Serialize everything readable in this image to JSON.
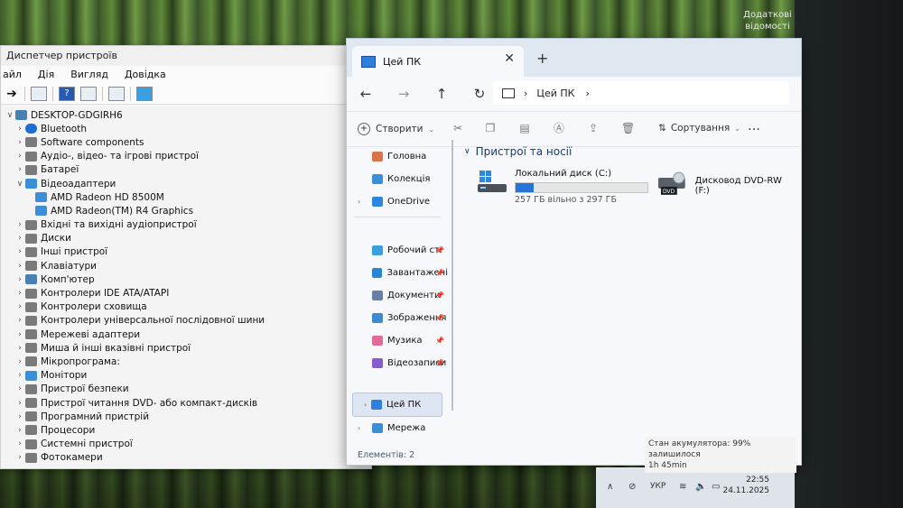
{
  "desktop": {
    "notification": "Додаткові відомості"
  },
  "device_manager": {
    "title": "Диспетчер пристроїв",
    "menu": [
      "айл",
      "Дія",
      "Вигляд",
      "Довідка"
    ],
    "tree": [
      {
        "label": "DESKTOP-GDGIRH6",
        "expander": "∨",
        "level": 0,
        "icon": "computer-icon"
      },
      {
        "label": "Bluetooth",
        "expander": "›",
        "level": 1,
        "icon": "bluetooth-icon"
      },
      {
        "label": "Software components",
        "expander": "›",
        "level": 1,
        "icon": "component-icon"
      },
      {
        "label": "Аудіо-, відео- та ігрові пристрої",
        "expander": "›",
        "level": 1,
        "icon": "speaker-icon"
      },
      {
        "label": "Батареї",
        "expander": "›",
        "level": 1,
        "icon": "battery-icon"
      },
      {
        "label": "Відеоадаптери",
        "expander": "∨",
        "level": 1,
        "icon": "display-adapter-icon"
      },
      {
        "label": "AMD Radeon HD 8500M",
        "expander": "",
        "level": 2,
        "icon": "display-adapter-icon"
      },
      {
        "label": "AMD Radeon(TM) R4 Graphics",
        "expander": "",
        "level": 2,
        "icon": "display-adapter-icon"
      },
      {
        "label": "Вхідні та вихідні аудіопристрої",
        "expander": "›",
        "level": 1,
        "icon": "audio-io-icon"
      },
      {
        "label": "Диски",
        "expander": "›",
        "level": 1,
        "icon": "disk-icon"
      },
      {
        "label": "Інші пристрої",
        "expander": "›",
        "level": 1,
        "icon": "unknown-device-icon"
      },
      {
        "label": "Клавіатури",
        "expander": "›",
        "level": 1,
        "icon": "keyboard-icon"
      },
      {
        "label": "Комп'ютер",
        "expander": "›",
        "level": 1,
        "icon": "computer-icon"
      },
      {
        "label": "Контролери IDE ATA/ATAPI",
        "expander": "›",
        "level": 1,
        "icon": "controller-icon"
      },
      {
        "label": "Контролери сховища",
        "expander": "›",
        "level": 1,
        "icon": "storage-icon"
      },
      {
        "label": "Контролери універсальної послідовної шини",
        "expander": "›",
        "level": 1,
        "icon": "usb-icon"
      },
      {
        "label": "Мережеві адаптери",
        "expander": "›",
        "level": 1,
        "icon": "network-icon"
      },
      {
        "label": "Миша й інші вказівні пристрої",
        "expander": "›",
        "level": 1,
        "icon": "mouse-icon"
      },
      {
        "label": "Мікропрограма:",
        "expander": "›",
        "level": 1,
        "icon": "firmware-icon"
      },
      {
        "label": "Монітори",
        "expander": "›",
        "level": 1,
        "icon": "monitor-icon"
      },
      {
        "label": "Пристрої безпеки",
        "expander": "›",
        "level": 1,
        "icon": "security-icon"
      },
      {
        "label": "Пристрої читання DVD- або компакт-дисків",
        "expander": "›",
        "level": 1,
        "icon": "dvd-icon"
      },
      {
        "label": "Програмний пристрій",
        "expander": "›",
        "level": 1,
        "icon": "software-device-icon"
      },
      {
        "label": "Процесори",
        "expander": "›",
        "level": 1,
        "icon": "cpu-icon"
      },
      {
        "label": "Системні пристрої",
        "expander": "›",
        "level": 1,
        "icon": "system-icon"
      },
      {
        "label": "Фотокамери",
        "expander": "›",
        "level": 1,
        "icon": "camera-icon"
      }
    ]
  },
  "explorer": {
    "tab_title": "Цей ПК",
    "tab_close": "✕",
    "new_tab": "+",
    "nav": {
      "back": "←",
      "forward": "→",
      "up": "↑",
      "refresh": "↻"
    },
    "address": {
      "location": "Цей ПК",
      "separator": "›"
    },
    "command_bar": {
      "new_label": "Створити",
      "sort_label": "Сортування",
      "more": "…"
    },
    "sidebar": {
      "top": [
        {
          "label": "Головна",
          "icon": "home-icon",
          "color": "#d9734a"
        },
        {
          "label": "Колекція",
          "icon": "gallery-icon",
          "color": "#3a8fd8"
        },
        {
          "label": "OneDrive",
          "icon": "onedrive-icon",
          "color": "#2f86e0"
        }
      ],
      "pinned": [
        {
          "label": "Робочий ст.",
          "icon": "desktop-icon",
          "color": "#3aa0e0"
        },
        {
          "label": "Завантажені",
          "icon": "download-icon",
          "color": "#2a86d1"
        },
        {
          "label": "Документи",
          "icon": "documents-icon",
          "color": "#6a7fa6"
        },
        {
          "label": "Зображення",
          "icon": "pictures-icon",
          "color": "#3c8ad0"
        },
        {
          "label": "Музика",
          "icon": "music-icon",
          "color": "#e06a9a"
        },
        {
          "label": "Відеозаписи",
          "icon": "videos-icon",
          "color": "#8a5ad0"
        }
      ],
      "bottom": [
        {
          "label": "Цей ПК",
          "icon": "this-pc-icon",
          "color": "#2f7fe0",
          "selected": true
        },
        {
          "label": "Мережа",
          "icon": "network-icon",
          "color": "#3a8fd8",
          "selected": false
        }
      ]
    },
    "section_title": "Пристрої та носії",
    "drives": [
      {
        "name": "Локальний диск (C:)",
        "free_text": "257 ГБ вільно з 297 ГБ",
        "used_fraction": 0.135,
        "icon": "windows-drive-icon"
      },
      {
        "name": "Дисковод DVD-RW (F:)",
        "icon": "dvd-drive-icon",
        "badge": "DVD"
      }
    ],
    "status": "Елементів: 2"
  },
  "battery_tooltip": {
    "line1": "Стан акумулятора: 99% залишилося",
    "line2": "1h 45min"
  },
  "taskbar": {
    "language": "УКР",
    "time": "22:55",
    "date": "24.11.2025",
    "chevron": "∧"
  }
}
